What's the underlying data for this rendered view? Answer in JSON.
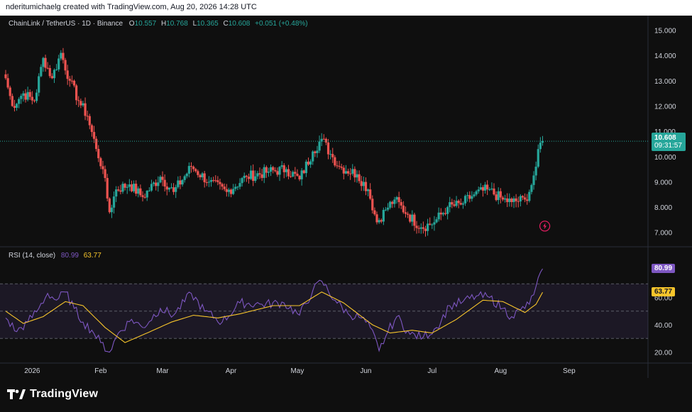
{
  "header": {
    "credit": "nderitumichaelg created with TradingView.com, Aug 20, 2026 14:28 UTC"
  },
  "legend": {
    "symbol": "ChainLink / TetherUS · 1D · Binance",
    "open_label": "O",
    "open": "10.557",
    "high_label": "H",
    "high": "10.768",
    "low_label": "L",
    "low": "10.365",
    "close_label": "C",
    "close": "10.608",
    "change": "+0.051 (+0.48%)"
  },
  "price_tag": {
    "price": "10.608",
    "countdown": "09:31:57"
  },
  "rsi_legend": {
    "title": "RSI (14, close)",
    "rsi_value": "80.99",
    "ma_value": "63.77"
  },
  "rsi_tags": {
    "rsi": "80.99",
    "ma": "63.77"
  },
  "brand": {
    "name": "TradingView"
  },
  "colors": {
    "up": "#26a69a",
    "down": "#ef5350",
    "rsi": "#7e57c2",
    "rsi_ma": "#f7c52b",
    "background": "#0f0f0f"
  },
  "chart_data": [
    {
      "type": "candlestick",
      "title": "ChainLink / TetherUS · 1D · Binance",
      "ylim": [
        6.6,
        15.35
      ],
      "y_ticks": [
        "15.000",
        "14.000",
        "13.000",
        "12.000",
        "11.000",
        "10.000",
        "9.000",
        "8.000",
        "7.000"
      ],
      "x_ticks": [
        "2026",
        "Feb",
        "Mar",
        "Apr",
        "May",
        "Jun",
        "Jul",
        "Aug",
        "Sep"
      ],
      "x_range": [
        "2025-12-20",
        "2026-09-20"
      ],
      "last_price": 10.608,
      "keypoints": [
        {
          "date": "2025-12-20",
          "close": 13.1
        },
        {
          "date": "2025-12-23",
          "close": 12.0
        },
        {
          "date": "2025-12-28",
          "close": 12.5
        },
        {
          "date": "2026-01-02",
          "close": 12.2
        },
        {
          "date": "2026-01-06",
          "close": 13.9
        },
        {
          "date": "2026-01-10",
          "close": 13.1
        },
        {
          "date": "2026-01-14",
          "close": 14.1
        },
        {
          "date": "2026-01-18",
          "close": 13.0
        },
        {
          "date": "2026-01-22",
          "close": 12.2
        },
        {
          "date": "2026-01-26",
          "close": 11.6
        },
        {
          "date": "2026-01-30",
          "close": 10.3
        },
        {
          "date": "2026-02-02",
          "close": 9.5
        },
        {
          "date": "2026-02-05",
          "close": 7.8
        },
        {
          "date": "2026-02-08",
          "close": 8.7
        },
        {
          "date": "2026-02-14",
          "close": 8.9
        },
        {
          "date": "2026-02-20",
          "close": 8.4
        },
        {
          "date": "2026-02-28",
          "close": 9.2
        },
        {
          "date": "2026-03-06",
          "close": 8.6
        },
        {
          "date": "2026-03-14",
          "close": 9.6
        },
        {
          "date": "2026-03-22",
          "close": 9.0
        },
        {
          "date": "2026-03-30",
          "close": 8.6
        },
        {
          "date": "2026-04-08",
          "close": 9.2
        },
        {
          "date": "2026-04-18",
          "close": 9.4
        },
        {
          "date": "2026-04-26",
          "close": 9.5
        },
        {
          "date": "2026-05-02",
          "close": 9.1
        },
        {
          "date": "2026-05-08",
          "close": 10.2
        },
        {
          "date": "2026-05-12",
          "close": 10.7
        },
        {
          "date": "2026-05-16",
          "close": 10.1
        },
        {
          "date": "2026-05-20",
          "close": 9.6
        },
        {
          "date": "2026-05-28",
          "close": 9.3
        },
        {
          "date": "2026-06-02",
          "close": 8.7
        },
        {
          "date": "2026-06-06",
          "close": 7.4
        },
        {
          "date": "2026-06-10",
          "close": 7.9
        },
        {
          "date": "2026-06-14",
          "close": 8.3
        },
        {
          "date": "2026-06-20",
          "close": 7.7
        },
        {
          "date": "2026-06-26",
          "close": 7.2
        },
        {
          "date": "2026-07-02",
          "close": 7.4
        },
        {
          "date": "2026-07-08",
          "close": 8.0
        },
        {
          "date": "2026-07-14",
          "close": 8.1
        },
        {
          "date": "2026-07-20",
          "close": 8.5
        },
        {
          "date": "2026-07-26",
          "close": 8.7
        },
        {
          "date": "2026-08-02",
          "close": 8.3
        },
        {
          "date": "2026-08-06",
          "close": 8.2
        },
        {
          "date": "2026-08-12",
          "close": 8.3
        },
        {
          "date": "2026-08-14",
          "close": 8.6
        },
        {
          "date": "2026-08-17",
          "close": 9.6
        },
        {
          "date": "2026-08-19",
          "close": 10.55
        },
        {
          "date": "2026-08-20",
          "close": 10.608
        }
      ]
    },
    {
      "type": "line",
      "title": "RSI (14, close)",
      "ylim": [
        12,
        95
      ],
      "y_ticks": [
        "60.00",
        "40.00",
        "20.00"
      ],
      "bands": [
        30,
        50,
        70
      ],
      "series": [
        {
          "name": "RSI",
          "color": "#7e57c2",
          "points": [
            {
              "date": "2025-12-20",
              "value": 45
            },
            {
              "date": "2025-12-25",
              "value": 35
            },
            {
              "date": "2025-12-30",
              "value": 42
            },
            {
              "date": "2026-01-04",
              "value": 52
            },
            {
              "date": "2026-01-08",
              "value": 63
            },
            {
              "date": "2026-01-12",
              "value": 58
            },
            {
              "date": "2026-01-16",
              "value": 64
            },
            {
              "date": "2026-01-20",
              "value": 52
            },
            {
              "date": "2026-01-24",
              "value": 42
            },
            {
              "date": "2026-01-28",
              "value": 36
            },
            {
              "date": "2026-02-01",
              "value": 27
            },
            {
              "date": "2026-02-05",
              "value": 20
            },
            {
              "date": "2026-02-09",
              "value": 34
            },
            {
              "date": "2026-02-15",
              "value": 44
            },
            {
              "date": "2026-02-20",
              "value": 38
            },
            {
              "date": "2026-02-28",
              "value": 52
            },
            {
              "date": "2026-03-06",
              "value": 47
            },
            {
              "date": "2026-03-14",
              "value": 63
            },
            {
              "date": "2026-03-20",
              "value": 50
            },
            {
              "date": "2026-03-28",
              "value": 42
            },
            {
              "date": "2026-04-05",
              "value": 56
            },
            {
              "date": "2026-04-15",
              "value": 55
            },
            {
              "date": "2026-04-25",
              "value": 56
            },
            {
              "date": "2026-05-02",
              "value": 47
            },
            {
              "date": "2026-05-08",
              "value": 65
            },
            {
              "date": "2026-05-12",
              "value": 72
            },
            {
              "date": "2026-05-18",
              "value": 58
            },
            {
              "date": "2026-05-24",
              "value": 48
            },
            {
              "date": "2026-05-30",
              "value": 45
            },
            {
              "date": "2026-06-03",
              "value": 38
            },
            {
              "date": "2026-06-07",
              "value": 21
            },
            {
              "date": "2026-06-11",
              "value": 35
            },
            {
              "date": "2026-06-15",
              "value": 46
            },
            {
              "date": "2026-06-21",
              "value": 33
            },
            {
              "date": "2026-06-27",
              "value": 31
            },
            {
              "date": "2026-07-03",
              "value": 38
            },
            {
              "date": "2026-07-09",
              "value": 54
            },
            {
              "date": "2026-07-15",
              "value": 57
            },
            {
              "date": "2026-07-21",
              "value": 61
            },
            {
              "date": "2026-07-27",
              "value": 60
            },
            {
              "date": "2026-08-02",
              "value": 52
            },
            {
              "date": "2026-08-06",
              "value": 46
            },
            {
              "date": "2026-08-10",
              "value": 51
            },
            {
              "date": "2026-08-14",
              "value": 55
            },
            {
              "date": "2026-08-17",
              "value": 68
            },
            {
              "date": "2026-08-20",
              "value": 80.99
            }
          ]
        },
        {
          "name": "MA",
          "color": "#f7c52b",
          "points": [
            {
              "date": "2025-12-20",
              "value": 50
            },
            {
              "date": "2025-12-28",
              "value": 41
            },
            {
              "date": "2026-01-06",
              "value": 46
            },
            {
              "date": "2026-01-16",
              "value": 57
            },
            {
              "date": "2026-01-24",
              "value": 54
            },
            {
              "date": "2026-02-03",
              "value": 38
            },
            {
              "date": "2026-02-12",
              "value": 27
            },
            {
              "date": "2026-02-22",
              "value": 34
            },
            {
              "date": "2026-03-05",
              "value": 42
            },
            {
              "date": "2026-03-15",
              "value": 47
            },
            {
              "date": "2026-03-26",
              "value": 45
            },
            {
              "date": "2026-04-05",
              "value": 48
            },
            {
              "date": "2026-04-20",
              "value": 54
            },
            {
              "date": "2026-05-02",
              "value": 54
            },
            {
              "date": "2026-05-12",
              "value": 64
            },
            {
              "date": "2026-05-22",
              "value": 56
            },
            {
              "date": "2026-06-04",
              "value": 40
            },
            {
              "date": "2026-06-12",
              "value": 34
            },
            {
              "date": "2026-06-22",
              "value": 36
            },
            {
              "date": "2026-07-01",
              "value": 34
            },
            {
              "date": "2026-07-12",
              "value": 44
            },
            {
              "date": "2026-07-24",
              "value": 58
            },
            {
              "date": "2026-08-02",
              "value": 57
            },
            {
              "date": "2026-08-12",
              "value": 49
            },
            {
              "date": "2026-08-17",
              "value": 55
            },
            {
              "date": "2026-08-20",
              "value": 63.77
            }
          ]
        }
      ]
    }
  ]
}
